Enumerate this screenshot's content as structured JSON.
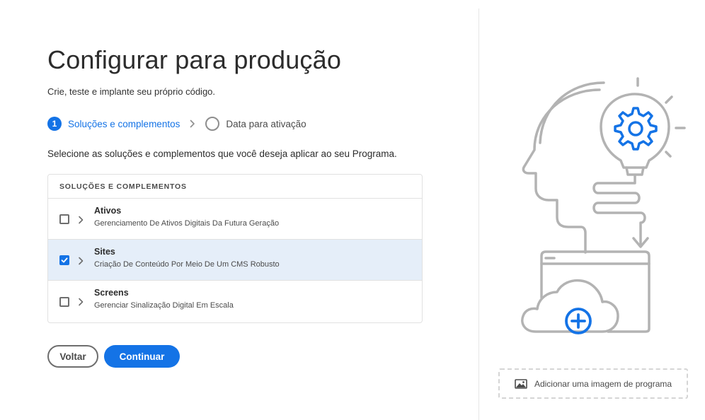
{
  "page": {
    "title": "Configurar para produção",
    "subtitle": "Crie, teste e implante seu próprio código.",
    "instructions": "Selecione as soluções e complementos que você deseja aplicar ao seu Programa."
  },
  "steps": [
    {
      "number": "1",
      "label": "Soluções e complementos",
      "active": true
    },
    {
      "label": "Data para ativação",
      "active": false
    }
  ],
  "table": {
    "header": "SOLUÇÕES E COMPLEMENTOS",
    "rows": [
      {
        "title": "Ativos",
        "description": "Gerenciamento De Ativos Digitais Da Futura Geração",
        "checked": false
      },
      {
        "title": "Sites",
        "description": "Criação De Conteúdo Por Meio De Um CMS Robusto",
        "checked": true
      },
      {
        "title": "Screens",
        "description": "Gerenciar Sinalização Digital Em Escala",
        "checked": false
      }
    ]
  },
  "buttons": {
    "back": "Voltar",
    "continue": "Continuar"
  },
  "sidebar": {
    "add_image": "Adicionar uma imagem de programa"
  },
  "colors": {
    "accent": "#1473e6",
    "selected_row": "#e5eef9",
    "illustration_gray": "#b3b3b3"
  }
}
